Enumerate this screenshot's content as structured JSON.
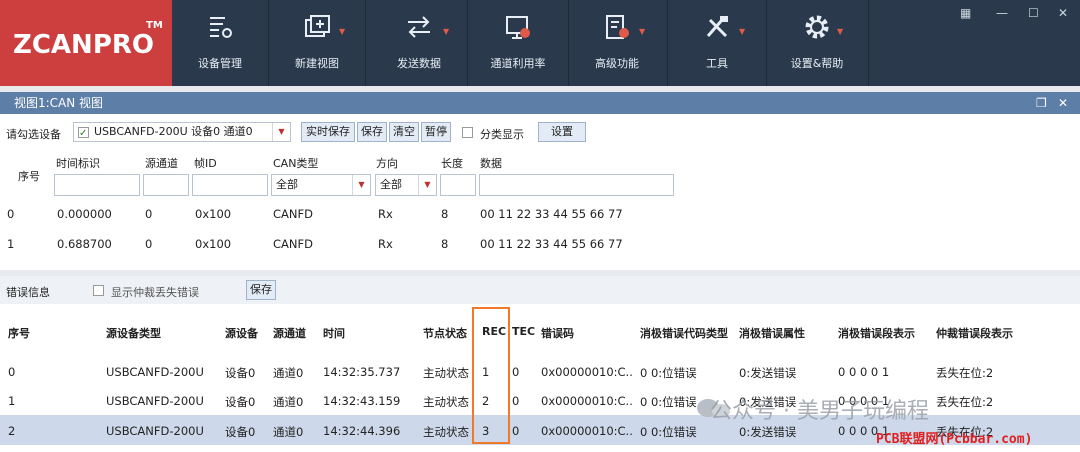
{
  "app": {
    "logo": "ZCANPRO",
    "tm": "TM"
  },
  "toolbar": [
    {
      "label": "设备管理",
      "icon": "device-manage-icon"
    },
    {
      "label": "新建视图",
      "icon": "new-view-icon"
    },
    {
      "label": "发送数据",
      "icon": "send-data-icon"
    },
    {
      "label": "通道利用率",
      "icon": "channel-usage-icon"
    },
    {
      "label": "高级功能",
      "icon": "advanced-icon"
    },
    {
      "label": "工具",
      "icon": "tools-icon"
    },
    {
      "label": "设置&帮助",
      "icon": "settings-icon"
    }
  ],
  "panel": {
    "title": "视图1:CAN 视图"
  },
  "device_row": {
    "label": "请勾选设备",
    "device": "USBCANFD-200U 设备0 通道0",
    "buttons": [
      "实时保存",
      "保存",
      "清空",
      "暂停"
    ],
    "classify_label": "分类显示",
    "settings_btn": "设置"
  },
  "frame_table": {
    "headers": [
      "序号",
      "时间标识",
      "源通道",
      "帧ID",
      "CAN类型",
      "方向",
      "长度",
      "数据"
    ],
    "filters": {
      "can_type": "全部",
      "direction": "全部"
    },
    "rows": [
      {
        "idx": "0",
        "time": "0.000000",
        "ch": "0",
        "id": "0x100",
        "type": "CANFD",
        "dir": "Rx",
        "len": "8",
        "data": "00 11 22 33 44 55 66 77"
      },
      {
        "idx": "1",
        "time": "0.688700",
        "ch": "0",
        "id": "0x100",
        "type": "CANFD",
        "dir": "Rx",
        "len": "8",
        "data": "00 11 22 33 44 55 66 77"
      }
    ]
  },
  "error_bar": {
    "label": "错误信息",
    "show_lost": "显示仲裁丢失错误",
    "save": "保存"
  },
  "error_table": {
    "headers": [
      "序号",
      "源设备类型",
      "源设备",
      "源通道",
      "时间",
      "节点状态",
      "REC",
      "TEC",
      "错误码",
      "消极错误代码类型",
      "消极错误属性",
      "消极错误段表示",
      "仲裁错误段表示"
    ],
    "rows": [
      {
        "idx": "0",
        "type": "USBCANFD-200U",
        "dev": "设备0",
        "ch": "通道0",
        "time": "14:32:35.737",
        "state": "主动状态",
        "rec": "1",
        "tec": "0",
        "code": "0x00000010:C...",
        "ptype": "0 0:位错误",
        "pattr": "0:发送错误",
        "pseg": "0 0 0 0 1",
        "aseg": "丢失在位:2"
      },
      {
        "idx": "1",
        "type": "USBCANFD-200U",
        "dev": "设备0",
        "ch": "通道0",
        "time": "14:32:43.159",
        "state": "主动状态",
        "rec": "2",
        "tec": "0",
        "code": "0x00000010:C...",
        "ptype": "0 0:位错误",
        "pattr": "0:发送错误",
        "pseg": "0 0 0 0 1",
        "aseg": "丢失在位:2"
      },
      {
        "idx": "2",
        "type": "USBCANFD-200U",
        "dev": "设备0",
        "ch": "通道0",
        "time": "14:32:44.396",
        "state": "主动状态",
        "rec": "3",
        "tec": "0",
        "code": "0x00000010:C...",
        "ptype": "0 0:位错误",
        "pattr": "0:发送错误",
        "pseg": "0 0 0 0 1",
        "aseg": "丢失在位:2"
      }
    ]
  },
  "watermark": {
    "text": "公众号 · 美男子玩编程",
    "site": "PCB联盟网(Pcbbar.com)"
  },
  "colors": {
    "logo_bg": "#cd3e3e",
    "toolbar_bg": "#2a3a4c",
    "title_bar": "#5d7ea6",
    "highlight": "#f07a2a",
    "selected_row": "#cdd9ea"
  }
}
